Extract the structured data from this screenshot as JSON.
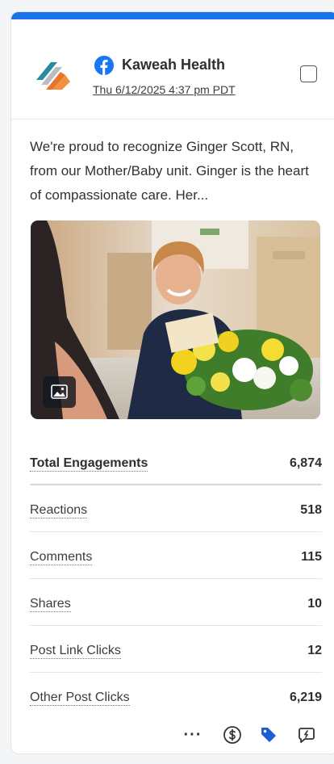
{
  "post": {
    "account_name": "Kaweah Health",
    "timestamp": "Thu 6/12/2025 4:37 pm PDT",
    "caption": "We're proud to recognize Ginger Scott, RN, from our Mother/Baby unit. Ginger is the heart of compassionate care. Her..."
  },
  "metrics": [
    {
      "label": "Total Engagements",
      "value": "6,874"
    },
    {
      "label": "Reactions",
      "value": "518"
    },
    {
      "label": "Comments",
      "value": "115"
    },
    {
      "label": "Shares",
      "value": "10"
    },
    {
      "label": "Post Link Clicks",
      "value": "12"
    },
    {
      "label": "Other Post Clicks",
      "value": "6,219"
    }
  ],
  "footer": {
    "more_label": "···"
  },
  "icons": {
    "network": "facebook-icon",
    "media_type": "image-icon",
    "actions": [
      "more-icon",
      "dollar-icon",
      "tag-icon",
      "reply-icon"
    ]
  },
  "colors": {
    "accent": "#1a73e8",
    "facebook": "#1877f2",
    "tag": "#1a5fd6"
  }
}
